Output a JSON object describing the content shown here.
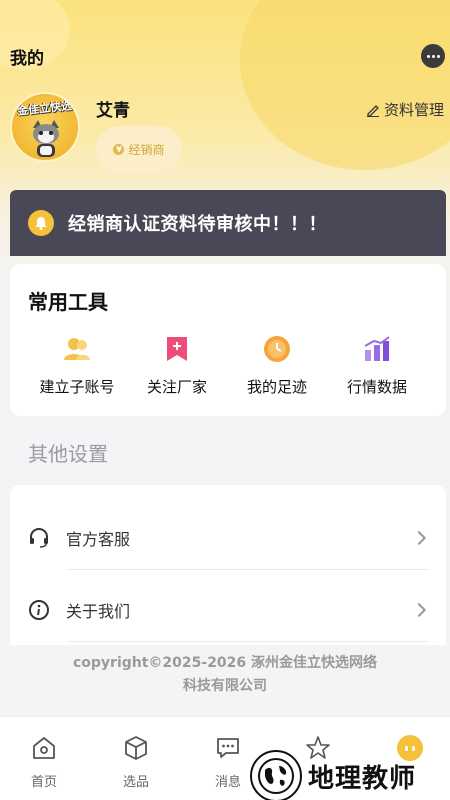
{
  "header": {
    "title": "我的",
    "avatar_logo": "金佳立快选"
  },
  "user": {
    "name": "艾青",
    "role_badge": "经销商",
    "badge_coin": "¥",
    "profile_link": "资料管理"
  },
  "notice": {
    "text": "经销商认证资料待审核中！！！"
  },
  "tools": {
    "title": "常用工具",
    "items": [
      {
        "label": "建立子账号",
        "icon": "users-icon",
        "color": "#f4c24a"
      },
      {
        "label": "关注厂家",
        "icon": "bookmark-plus-icon",
        "color": "#ee4d7a"
      },
      {
        "label": "我的足迹",
        "icon": "clock-icon",
        "color": "#f7a53a"
      },
      {
        "label": "行情数据",
        "icon": "bar-chart-icon",
        "color": "#9b6ae6"
      }
    ]
  },
  "other_settings": {
    "title": "其他设置",
    "items": [
      {
        "label": "官方客服",
        "icon": "headset-icon"
      },
      {
        "label": "关于我们",
        "icon": "info-icon"
      }
    ]
  },
  "footer": {
    "line1": "copyright©2025-2026 涿州金佳立快选网络",
    "line2": "科技有限公司"
  },
  "tabbar": {
    "items": [
      {
        "label": "首页",
        "icon": "home-icon"
      },
      {
        "label": "选品",
        "icon": "cube-icon"
      },
      {
        "label": "消息",
        "icon": "message-icon"
      },
      {
        "label": "",
        "icon": "star-icon"
      },
      {
        "label": "",
        "icon": "profile-icon",
        "active": true
      }
    ]
  },
  "watermark": {
    "text": "地理教师"
  },
  "colors": {
    "accent": "#f6c13a",
    "notice_bg": "#484856",
    "header_gradient_top": "#fbe27e"
  }
}
